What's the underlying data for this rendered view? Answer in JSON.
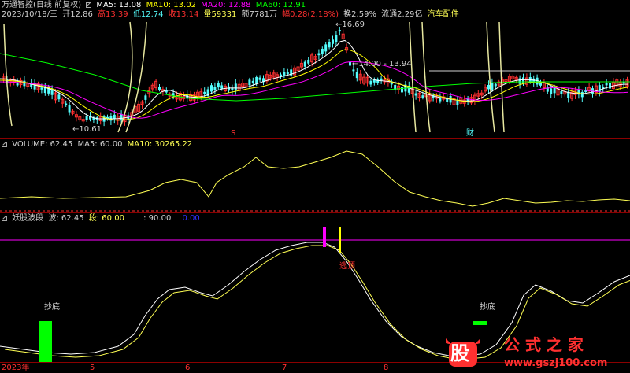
{
  "colors": {
    "background": "#000000",
    "separator": "#8b0000",
    "ma5": "#ffffff",
    "ma10": "#ffff00",
    "ma20": "#ff00ff",
    "ma60": "#00ff00",
    "up": "#ff3030",
    "down": "#54fcfc",
    "label_white": "#d0d0d0",
    "label_yellow": "#ffff54",
    "label_red": "#ff3030",
    "label_cyan": "#54fcfc",
    "label_blue": "#3030ff"
  },
  "header": {
    "stock_name": "万通智控(日线 前复权)",
    "ma5_label": "MA5: 13.08",
    "ma10_label": "MA10: 13.02",
    "ma20_label": "MA20: 12.88",
    "ma60_label": "MA60: 12.91",
    "date": "2023/10/18/三",
    "open": "开12.86",
    "high": "高13.39",
    "low": "低12.74",
    "close": "收13.14",
    "volume": "量59331",
    "amount": "额7781万",
    "change": "幅0.28(2.18%)",
    "turnover": "换2.59%",
    "float_cap": "流通2.29亿",
    "sector": "汽车配件"
  },
  "price_panel": {
    "high_annotation": "16.69",
    "low_annotation": "10.61",
    "range_annotation": "14.00 - 13.94",
    "marker_s": "S",
    "marker_cai": "财"
  },
  "volume_panel": {
    "title": "VOLUME: 62.45",
    "ma5": "MA5: 60.00",
    "ma10": "MA10: 30265.22"
  },
  "indicator_panel": {
    "title": "妖股波段",
    "bo_label": "波: 62.45",
    "duan_label": "段: 60.00",
    "level_label": ": 90.00",
    "zero_label": "0.00",
    "signal_bottom_left": "抄底",
    "signal_bottom_right": "抄底",
    "signal_top": "逃顶"
  },
  "x_axis": {
    "labels": [
      "2023年",
      "5",
      "6",
      "7",
      "8"
    ]
  },
  "watermark": {
    "logo_char": "股",
    "text": "公 式 之 家",
    "url": "www.gszj100.com"
  }
}
